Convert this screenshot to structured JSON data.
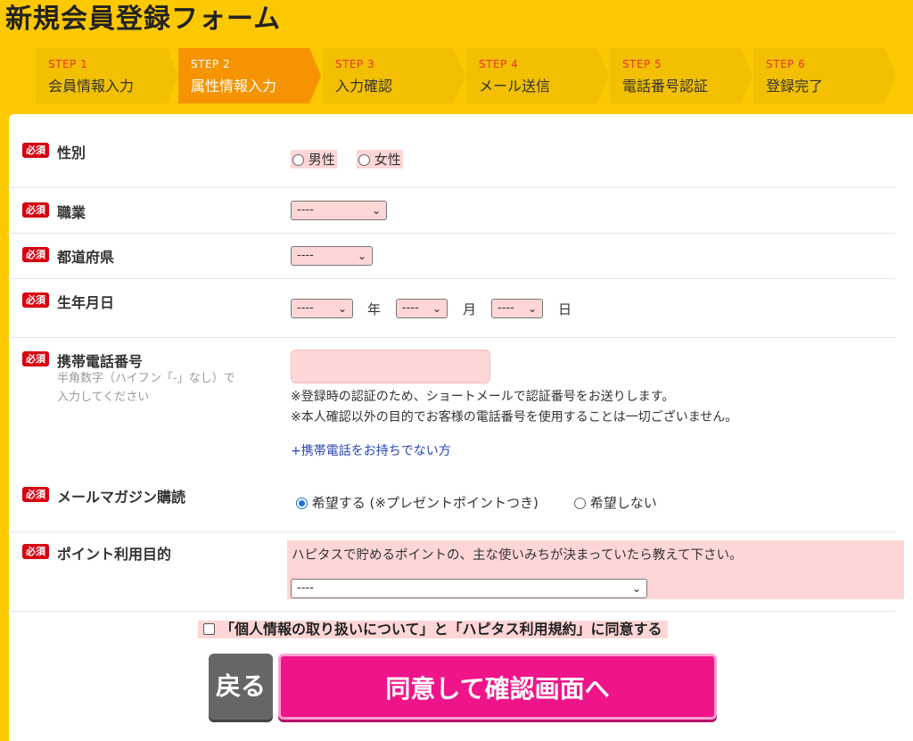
{
  "page": {
    "title": "新規会員登録フォーム"
  },
  "steps": [
    {
      "num": "STEP 1",
      "label": "会員情報入力",
      "active": false
    },
    {
      "num": "STEP 2",
      "label": "属性情報入力",
      "active": true
    },
    {
      "num": "STEP 3",
      "label": "入力確認",
      "active": false
    },
    {
      "num": "STEP 4",
      "label": "メール送信",
      "active": false
    },
    {
      "num": "STEP 5",
      "label": "電話番号認証",
      "active": false
    },
    {
      "num": "STEP 6",
      "label": "登録完了",
      "active": false
    }
  ],
  "required_badge": "必須",
  "gender": {
    "label": "性別",
    "options": [
      {
        "label": "男性",
        "checked": false
      },
      {
        "label": "女性",
        "checked": false
      }
    ]
  },
  "occupation": {
    "label": "職業",
    "selected": "----"
  },
  "prefecture": {
    "label": "都道府県",
    "selected": "----"
  },
  "birthdate": {
    "label": "生年月日",
    "year": {
      "selected": "----",
      "unit": "年"
    },
    "month": {
      "selected": "----",
      "unit": "月"
    },
    "day": {
      "selected": "----",
      "unit": "日"
    }
  },
  "mobile": {
    "label": "携帯電話番号",
    "sub_note_line1": "半角数字（ハイフン「-」なし）で",
    "sub_note_line2": "入力してください",
    "value": "",
    "note1": "※登録時の認証のため、ショートメールで認証番号をお送りします。",
    "note2": "※本人確認以外の目的でお客様の電話番号を使用することは一切ございません。",
    "no_phone_link": "+携帯電話をお持ちでない方"
  },
  "newsletter": {
    "label": "メールマガジン購読",
    "options": [
      {
        "label": "希望する (※プレゼントポイントつき)",
        "checked": true
      },
      {
        "label": "希望しない",
        "checked": false
      }
    ]
  },
  "point_purpose": {
    "label": "ポイント利用目的",
    "description": "ハピタスで貯めるポイントの、主な使いみちが決まっていたら教えて下さい。",
    "selected": "----"
  },
  "agreement": {
    "label": "「個人情報の取り扱いについて」と「ハピタス利用規約」に同意する",
    "checked": false
  },
  "buttons": {
    "back": "戻る",
    "confirm": "同意して確認画面へ"
  },
  "colors": {
    "background": "#fcc800",
    "required": "#d7000f",
    "field_pink": "#ffd6d6",
    "step_active": "#f59300",
    "confirm_button": "#f0148a"
  }
}
